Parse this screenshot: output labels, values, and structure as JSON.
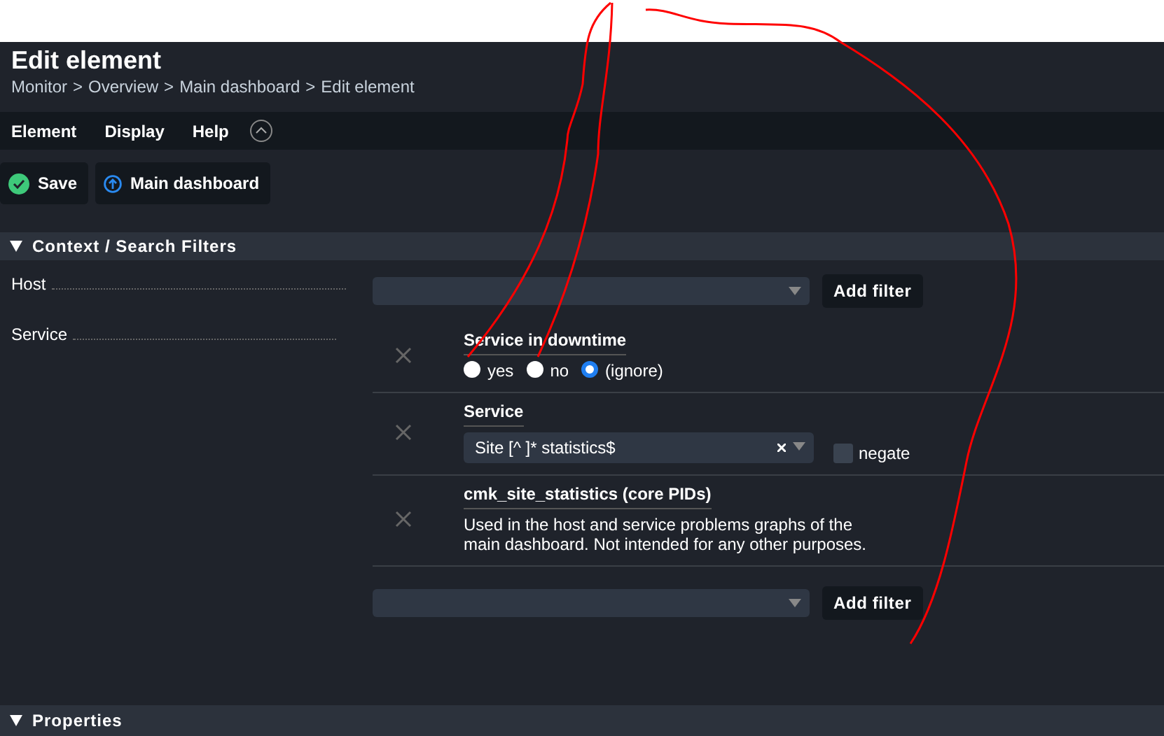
{
  "header": {
    "title": "Edit element",
    "breadcrumb": [
      "Monitor",
      "Overview",
      "Main dashboard",
      "Edit element"
    ],
    "separator": ">"
  },
  "menu": [
    {
      "label": "Element"
    },
    {
      "label": "Display"
    },
    {
      "label": "Help"
    }
  ],
  "toolbar": [
    {
      "label": "Save"
    },
    {
      "label": "Main dashboard"
    }
  ],
  "context_section": {
    "title": "Context / Search Filters",
    "expanded": true,
    "host": {
      "label": "Host",
      "button": "Add filter"
    },
    "service": {
      "label": "Service",
      "filters": [
        {
          "kind": "radio",
          "title": "Service in downtime",
          "options": [
            {
              "label": "yes",
              "selected": false
            },
            {
              "label": "no",
              "selected": false
            },
            {
              "label": "(ignore)",
              "selected": true
            }
          ]
        },
        {
          "kind": "select",
          "title": "Service",
          "value": "Site [^ ]* statistics$",
          "negate_label": "negate",
          "negate": false
        },
        {
          "kind": "text",
          "title": "cmk_site_statistics (core PIDs)",
          "text": "Used in the host and service problems graphs of the main dashboard. Not intended for any other purposes."
        }
      ],
      "button": "Add filter"
    }
  },
  "properties_section": {
    "title": "Properties",
    "expanded": true
  }
}
